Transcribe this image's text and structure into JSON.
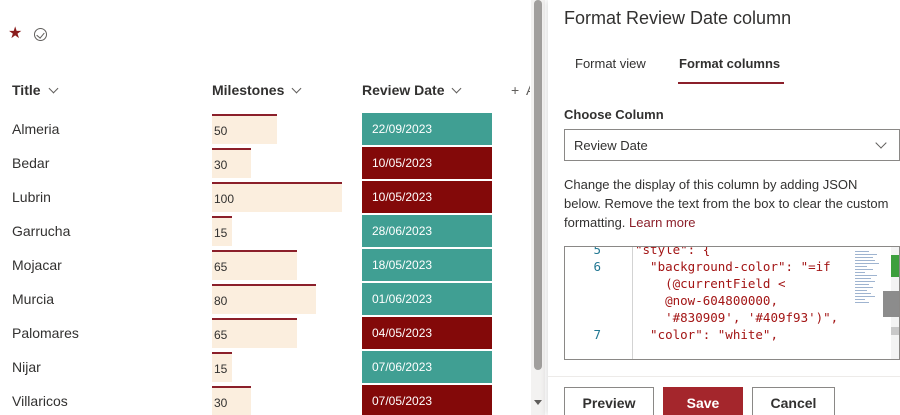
{
  "list": {
    "columns": {
      "title": "Title",
      "milestones": "Milestones",
      "review_date": "Review Date",
      "add_column": "+",
      "truncated_col": "A"
    },
    "rows": [
      {
        "title": "Almeria",
        "milestones": "50",
        "review_date": "22/09/2023",
        "status": "ok"
      },
      {
        "title": "Bedar",
        "milestones": "30",
        "review_date": "10/05/2023",
        "status": "late"
      },
      {
        "title": "Lubrin",
        "milestones": "100",
        "review_date": "10/05/2023",
        "status": "late"
      },
      {
        "title": "Garrucha",
        "milestones": "15",
        "review_date": "28/06/2023",
        "status": "ok"
      },
      {
        "title": "Mojacar",
        "milestones": "65",
        "review_date": "18/05/2023",
        "status": "ok"
      },
      {
        "title": "Murcia",
        "milestones": "80",
        "review_date": "01/06/2023",
        "status": "ok"
      },
      {
        "title": "Palomares",
        "milestones": "65",
        "review_date": "04/05/2023",
        "status": "late"
      },
      {
        "title": "Nijar",
        "milestones": "15",
        "review_date": "07/06/2023",
        "status": "ok"
      },
      {
        "title": "Villaricos",
        "milestones": "30",
        "review_date": "07/05/2023",
        "status": "late"
      }
    ],
    "milestones_max": 100,
    "icons": {
      "favorite": "star-icon",
      "status": "check-circle-icon"
    }
  },
  "colors": {
    "ok": "#409f93",
    "late": "#830909",
    "accent": "#a4262c",
    "bar_fill": "#fbeede",
    "bar_line": "#8b1f2a"
  },
  "panel": {
    "title": "Format Review Date column",
    "tabs": [
      {
        "label": "Format view",
        "active": false
      },
      {
        "label": "Format columns",
        "active": true
      }
    ],
    "choose_column_label": "Choose Column",
    "selected_column": "Review Date",
    "description": "Change the display of this column by adding JSON below. Remove the text from the box to clear the custom formatting.",
    "learn_more": "Learn more",
    "code_lines": [
      {
        "num": "5",
        "text": "\"style\": {"
      },
      {
        "num": "6",
        "text": "  \"background-color\": \"=if"
      },
      {
        "num": "",
        "text": "    (@currentField <"
      },
      {
        "num": "",
        "text": "    @now-604800000,"
      },
      {
        "num": "",
        "text": "    '#830909', '#409f93')\","
      },
      {
        "num": "7",
        "text": "  \"color\": \"white\","
      }
    ],
    "buttons": {
      "preview": "Preview",
      "save": "Save",
      "cancel": "Cancel"
    }
  }
}
